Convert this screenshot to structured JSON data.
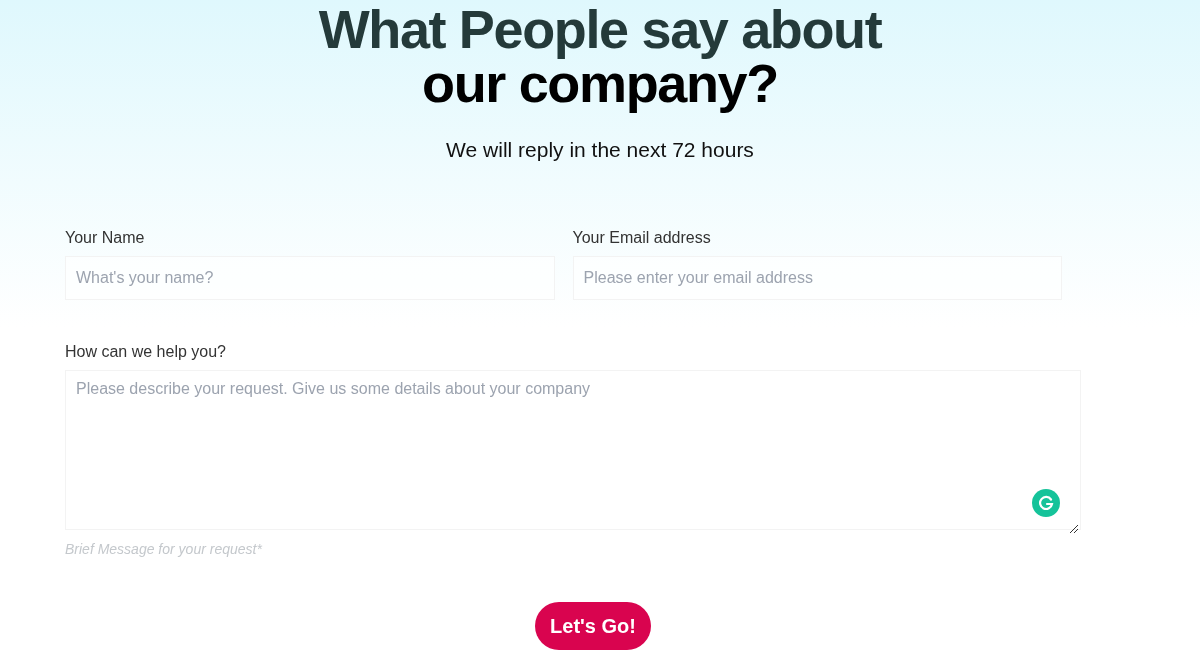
{
  "heading": {
    "line_1": "What People say about",
    "line_2": "our company?"
  },
  "subtitle": "We will reply in the next 72 hours",
  "fields": [
    {
      "label": "Your Name",
      "placeholder": "What's your name?"
    },
    {
      "label": "Your Email address",
      "placeholder": "Please enter your email address"
    }
  ],
  "message": {
    "label": "How can we help you?",
    "placeholder": "Please describe your request. Give us some details about your company",
    "hint": "Brief Message for your request*"
  },
  "submit": "Let's Go!"
}
